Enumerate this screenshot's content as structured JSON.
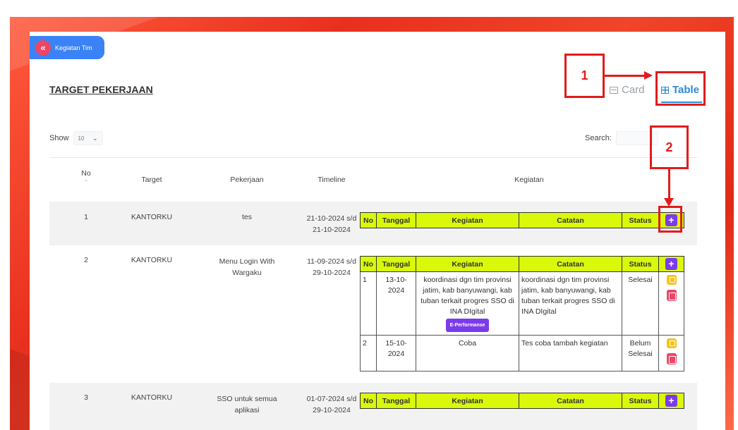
{
  "back_button": {
    "label": "Kegiatan Tim",
    "icon": "double-chevron-left-icon"
  },
  "page_title": "TARGET PEKERJAAN",
  "view_toggle": {
    "card_label": "Card",
    "table_label": "Table",
    "active": "Table"
  },
  "annotations": {
    "one": "1",
    "two": "2"
  },
  "show": {
    "label": "Show",
    "value": "10"
  },
  "search": {
    "label": "Search:",
    "value": ""
  },
  "table": {
    "headers": {
      "no": "No",
      "target": "Target",
      "pekerjaan": "Pekerjaan",
      "timeline": "Timeline",
      "kegiatan": "Kegiatan"
    },
    "sub_headers": {
      "no": "No",
      "tanggal": "Tanggal",
      "kegiatan": "Kegiatan",
      "catatan": "Catatan",
      "status": "Status"
    },
    "rows": [
      {
        "no": "1",
        "target": "KANTORKU",
        "pekerjaan": "tes",
        "timeline_start": "21-10-2024 s/d",
        "timeline_end": "21-10-2024",
        "activities": []
      },
      {
        "no": "2",
        "target": "KANTORKU",
        "pekerjaan": "Menu Login With Wargaku",
        "timeline_start": "11-09-2024 s/d",
        "timeline_end": "29-10-2024",
        "activities": [
          {
            "no": "1",
            "tanggal": "13-10-2024",
            "kegiatan": "koordinasi dgn tim provinsi jatim, kab banyuwangi, kab tuban terkait progres SSO di INA DIgital",
            "tag": "E-Performanse",
            "catatan": "koordinasi dgn tim provinsi jatim, kab banyuwangi, kab tuban terkait progres SSO di INA DIgital",
            "status": "Selesai"
          },
          {
            "no": "2",
            "tanggal": "15-10-2024",
            "kegiatan": "Coba",
            "tag": "",
            "catatan": "Tes coba tambah kegiatan",
            "status": "Belum Selesai"
          }
        ]
      },
      {
        "no": "3",
        "target": "KANTORKU",
        "pekerjaan": "SSO untuk semua aplikasi",
        "timeline_start": "01-07-2024 s/d",
        "timeline_end": "29-10-2024",
        "activities": []
      }
    ]
  },
  "colors": {
    "frame": "#e8301e",
    "accent": "#2b8ad8",
    "sub_header": "#d9f80a",
    "plus": "#7c3aed",
    "delete": "#ef4565",
    "edit": "#f5c518",
    "annotation": "#e31b1b"
  }
}
